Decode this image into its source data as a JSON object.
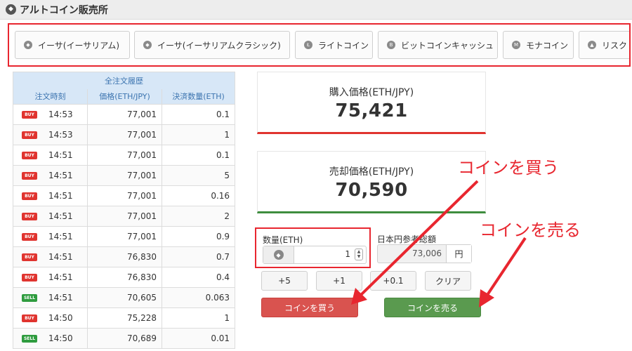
{
  "header": {
    "title": "アルトコイン販売所",
    "icon": "coin-icon"
  },
  "tabs": [
    {
      "label": "イーサ(イーサリアム)",
      "icon": "ethereum-icon",
      "glyph": "◆"
    },
    {
      "label": "イーサ(イーサリアムクラシック)",
      "icon": "ethereum-classic-icon",
      "glyph": "◆"
    },
    {
      "label": "ライトコイン",
      "icon": "litecoin-icon",
      "glyph": "Ł"
    },
    {
      "label": "ビットコインキャッシュ",
      "icon": "bitcoin-cash-icon",
      "glyph": "B"
    },
    {
      "label": "モナコイン",
      "icon": "monacoin-icon",
      "glyph": "M"
    },
    {
      "label": "リスク",
      "icon": "lisk-icon",
      "glyph": "▲"
    }
  ],
  "history": {
    "caption": "全注文履歴",
    "columns": [
      "注文時刻",
      "価格(ETH/JPY)",
      "決済数量(ETH)"
    ],
    "rows": [
      {
        "side": "BUY",
        "time": "14:53",
        "price": "77,001",
        "qty": "0.1"
      },
      {
        "side": "BUY",
        "time": "14:53",
        "price": "77,001",
        "qty": "1"
      },
      {
        "side": "BUY",
        "time": "14:51",
        "price": "77,001",
        "qty": "0.1"
      },
      {
        "side": "BUY",
        "time": "14:51",
        "price": "77,001",
        "qty": "5"
      },
      {
        "side": "BUY",
        "time": "14:51",
        "price": "77,001",
        "qty": "0.16"
      },
      {
        "side": "BUY",
        "time": "14:51",
        "price": "77,001",
        "qty": "2"
      },
      {
        "side": "BUY",
        "time": "14:51",
        "price": "77,001",
        "qty": "0.9"
      },
      {
        "side": "BUY",
        "time": "14:51",
        "price": "76,830",
        "qty": "0.7"
      },
      {
        "side": "BUY",
        "time": "14:51",
        "price": "76,830",
        "qty": "0.4"
      },
      {
        "side": "SELL",
        "time": "14:51",
        "price": "70,605",
        "qty": "0.063"
      },
      {
        "side": "BUY",
        "time": "14:50",
        "price": "75,228",
        "qty": "1"
      },
      {
        "side": "SELL",
        "time": "14:50",
        "price": "70,689",
        "qty": "0.01"
      }
    ]
  },
  "buy_price": {
    "label": "購入価格(ETH/JPY)",
    "value": "75,421"
  },
  "sell_price": {
    "label": "売却価格(ETH/JPY)",
    "value": "70,590"
  },
  "quantity": {
    "label": "数量(ETH)",
    "value": "1",
    "icon": "ethereum-icon"
  },
  "jpy_total": {
    "label": "日本円参考総額",
    "value": "73,006",
    "unit": "円"
  },
  "step_buttons": [
    "+5",
    "+1",
    "+0.1",
    "クリア"
  ],
  "buy_button": "コインを買う",
  "sell_button": "コインを売る",
  "annotations": {
    "buy": "コインを買う",
    "sell": "コインを売る"
  },
  "colors": {
    "buy": "#e0342f",
    "sell": "#3e8d3e",
    "highlight": "#e8262f",
    "table_header": "#d7e7f7"
  }
}
